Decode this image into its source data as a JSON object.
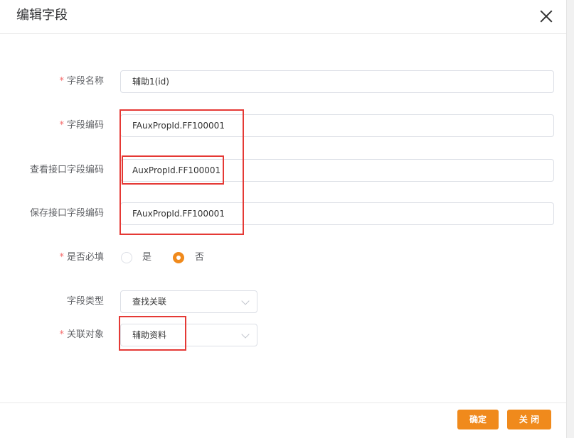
{
  "dialog": {
    "title": "编辑字段"
  },
  "form": {
    "required_mark": "*",
    "field_name": {
      "label": "字段名称",
      "value": "辅助1(id)"
    },
    "field_code": {
      "label": "字段编码",
      "value": "FAuxPropId.FF100001"
    },
    "view_api_code": {
      "label": "查看接口字段编码",
      "value": "AuxPropId.FF100001"
    },
    "save_api_code": {
      "label": "保存接口字段编码",
      "value": "FAuxPropId.FF100001"
    },
    "required": {
      "label": "是否必填",
      "options": [
        "是",
        "否"
      ],
      "selected": "否"
    },
    "field_type": {
      "label": "字段类型",
      "value": "查找关联"
    },
    "related_object": {
      "label": "关联对象",
      "value": "辅助资料"
    }
  },
  "footer": {
    "confirm_label": "确定",
    "close_label": "关 闭"
  },
  "colors": {
    "accent": "#f08a1c",
    "required": "#f56c6c",
    "annotation": "#e53935"
  },
  "icons": {
    "close": "close-icon",
    "dropdown": "chevron-down-icon"
  }
}
